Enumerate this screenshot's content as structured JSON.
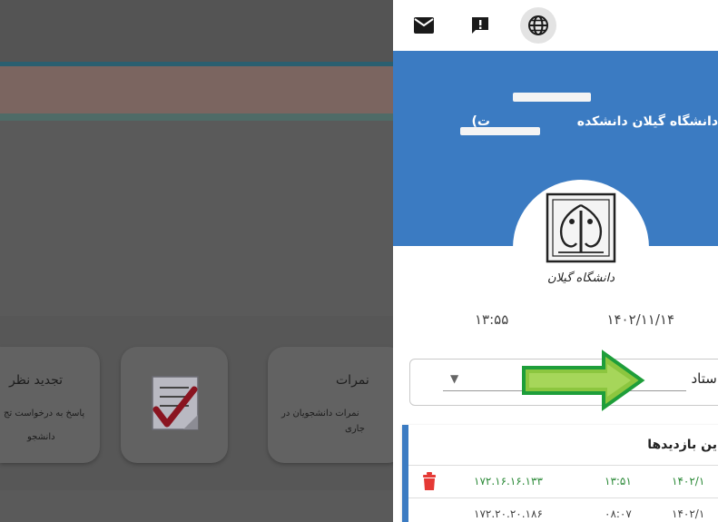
{
  "background": {
    "cards": [
      {
        "title": "نمرات",
        "desc_line1": "نمرات دانشجویان در",
        "desc_line2": "جاری"
      },
      {
        "title": "تجدید نظر",
        "desc_line1": "پاسخ به درخواست تج",
        "desc_line2": "دانشجو"
      }
    ]
  },
  "toolbar": {
    "icons": [
      "mail-icon",
      "feedback-icon",
      "globe-icon"
    ]
  },
  "profile": {
    "university_line": "دانشگاه گیلان دانشکده",
    "university_suffix": "ت)",
    "date": "۱۴۰۲/۱۱/۱۴",
    "time": "۱۳:۵۵",
    "logo_caption": "دانشگاه گیلان"
  },
  "role_select": {
    "selected": "استاد"
  },
  "visits": {
    "title": "ین بازدیدها",
    "rows": [
      {
        "date": "۱۴۰۲/۱",
        "time": "۱۳:۵۱",
        "ip": "۱۷۲.۱۶.۱۶.۱۳۳",
        "current": true
      },
      {
        "date": "۱۴۰۲/۱",
        "time": "۰۸:۰۷",
        "ip": "۱۷۲.۲۰.۲۰.۱۸۶",
        "current": false
      }
    ]
  },
  "colors": {
    "header_blue": "#3b7bc2",
    "accent_green": "#2e8b3a",
    "delete_red": "#e53935",
    "overlay_gray": "#5c5c5c"
  }
}
